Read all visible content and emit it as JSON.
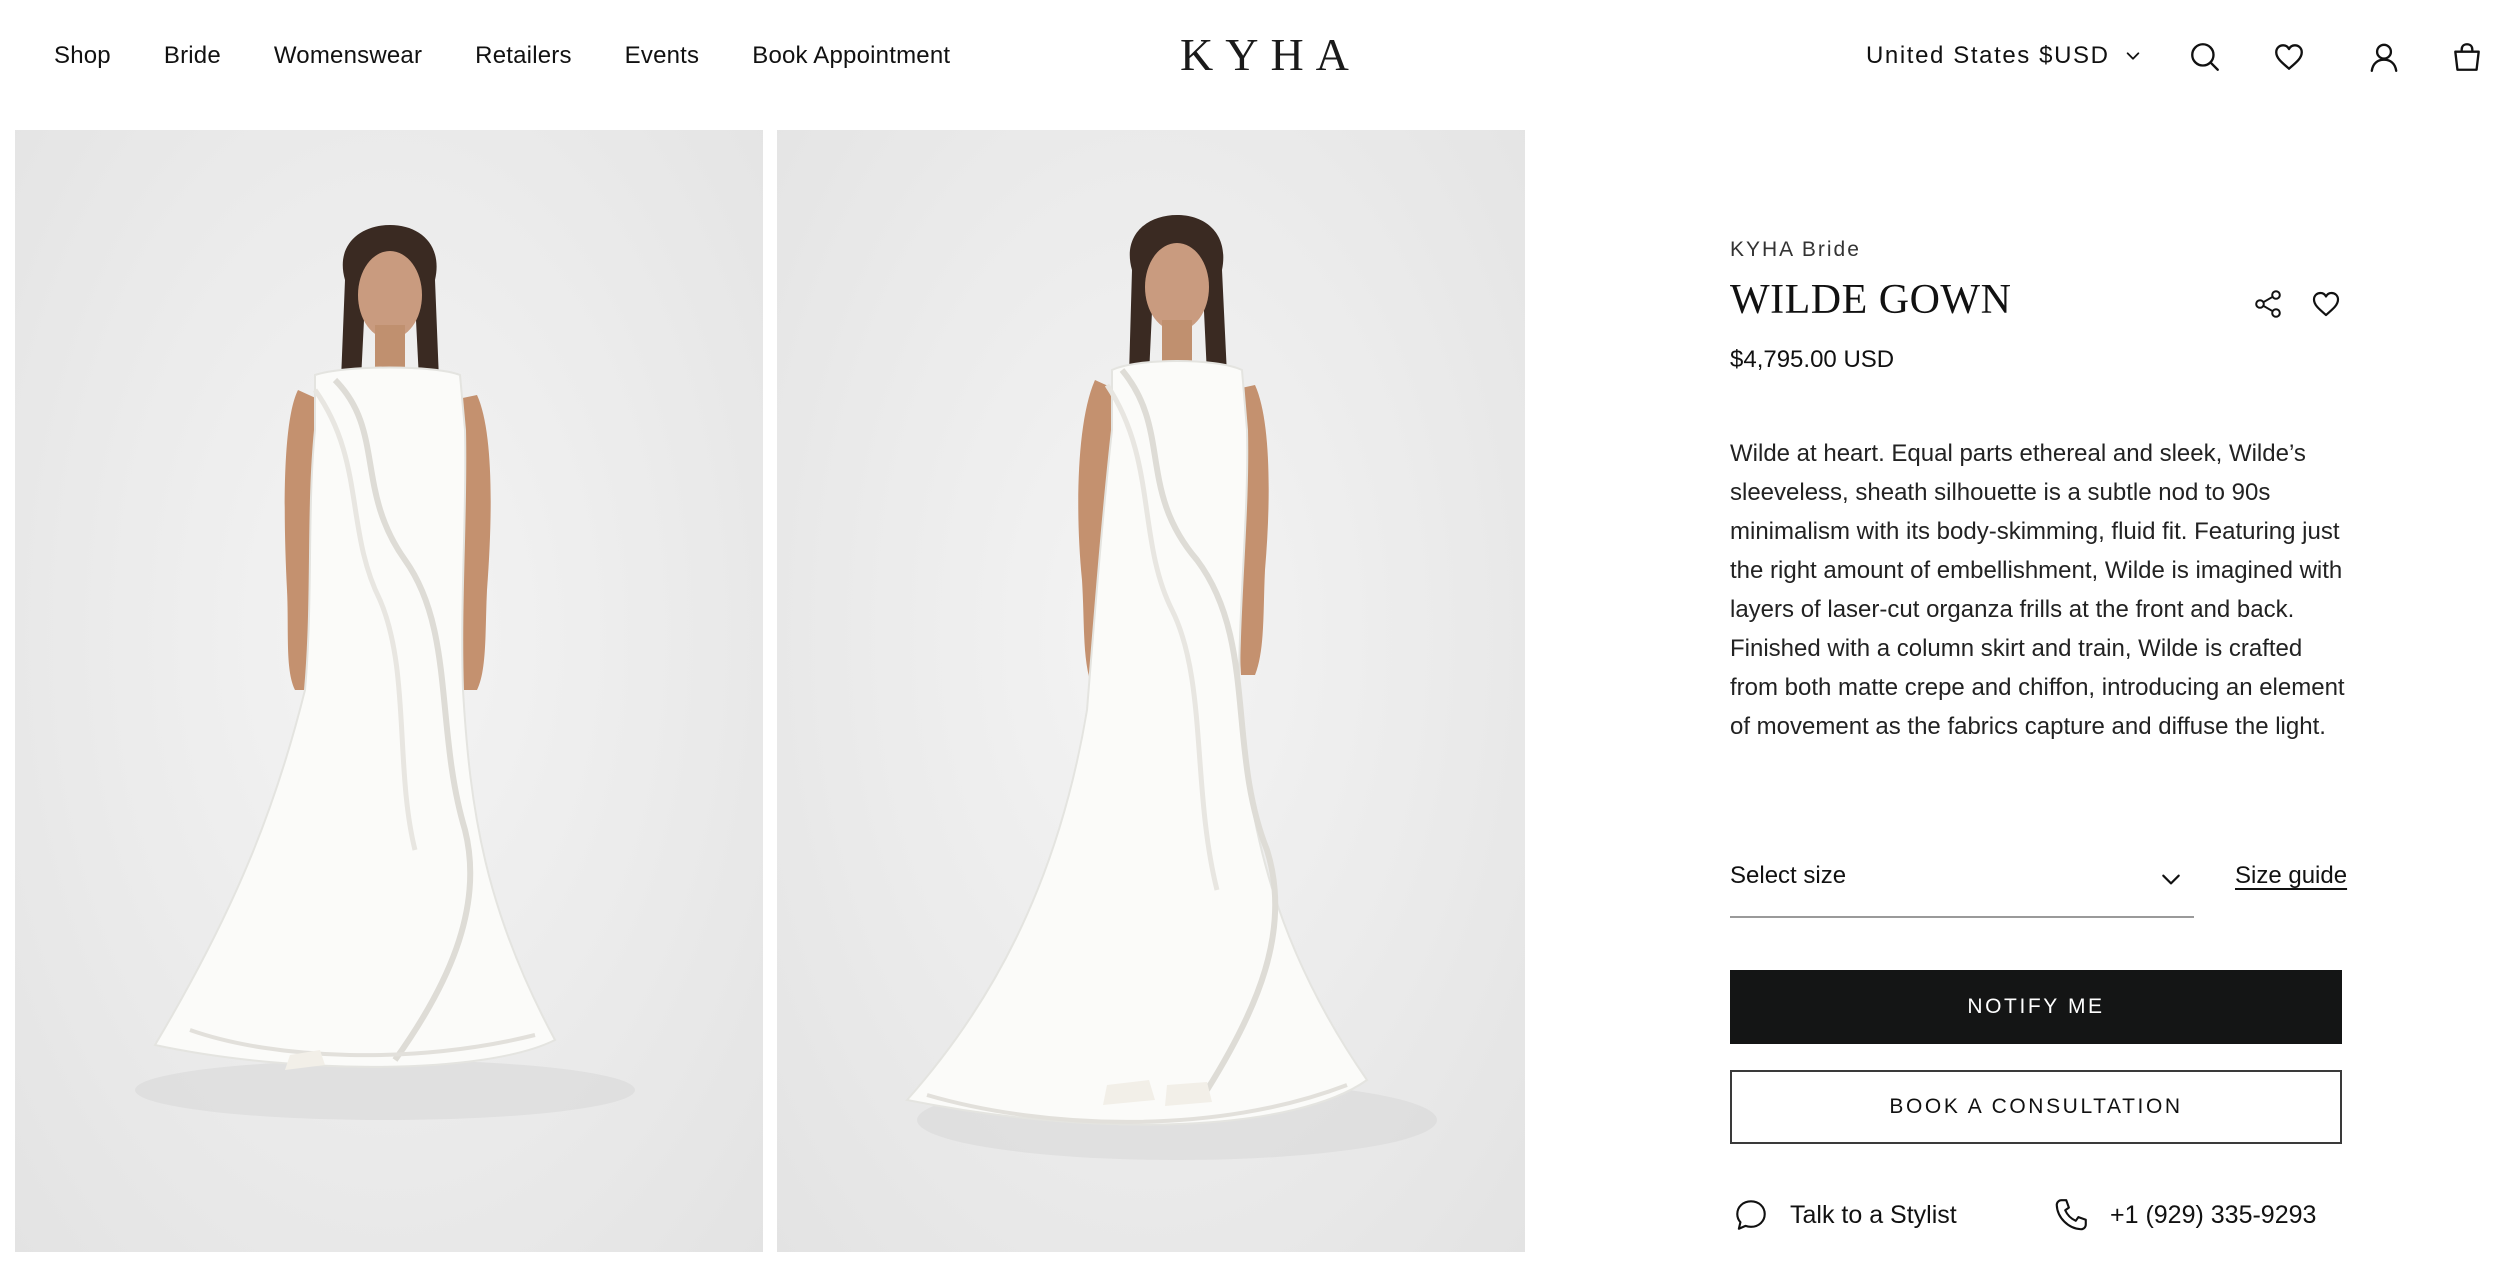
{
  "nav": {
    "items": [
      "Shop",
      "Bride",
      "Womenswear",
      "Retailers",
      "Events",
      "Book Appointment"
    ]
  },
  "brand": {
    "logo_text": "KYHA"
  },
  "header": {
    "currency": "United States $USD",
    "icons": [
      "search-icon",
      "heart-icon",
      "account-icon",
      "bag-icon"
    ]
  },
  "gallery": {
    "images": [
      "gown-front-view",
      "gown-angled-view"
    ]
  },
  "product": {
    "collection": "KYHA Bride",
    "name": "WILDE GOWN",
    "price": "$4,795.00 USD",
    "description": "Wilde at heart. Equal parts ethereal and sleek, Wilde’s sleeveless, sheath silhouette is a subtle nod to 90s minimalism with its body-skimming, fluid fit. Featuring just the right amount of embellishment, Wilde is imagined with layers of laser-cut organza frills at the front and back. Finished with a column skirt and train, Wilde is crafted from both matte crepe and chiffon, introducing an element of movement as the fabrics capture and diffuse the light.",
    "size_placeholder": "Select size",
    "size_guide": "Size guide",
    "notify_label": "NOTIFY ME",
    "consult_label": "BOOK A CONSULTATION",
    "stylist_label": "Talk to a Stylist",
    "phone": "+1 (929) 335-9293"
  },
  "colors": {
    "primary_button": "#141515",
    "background": "#ffffff",
    "photo_background": "#e9e9e9"
  }
}
